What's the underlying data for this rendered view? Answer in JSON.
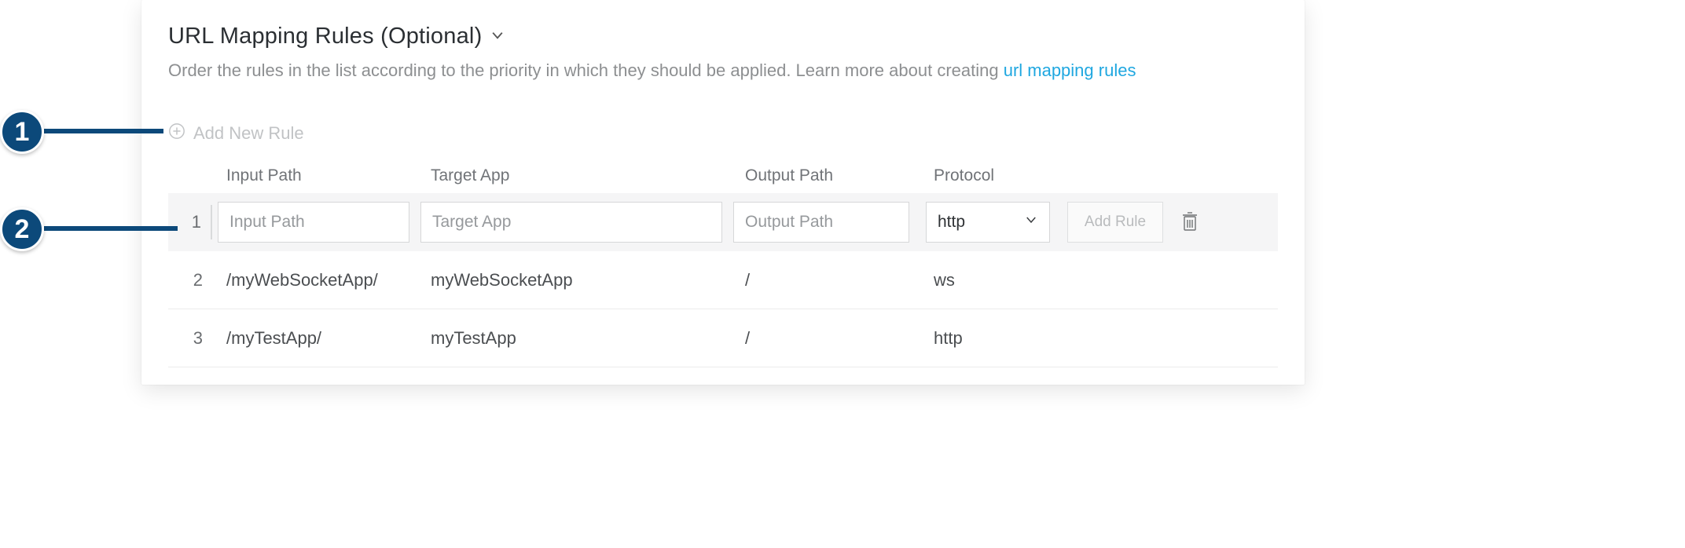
{
  "callouts": {
    "one": "1",
    "two": "2"
  },
  "section": {
    "title": "URL Mapping Rules (Optional)",
    "subtitle_prefix": "Order the rules in the list according to the priority in which they should be applied. Learn more about creating ",
    "subtitle_link": "url mapping rules"
  },
  "add_new": {
    "label": "Add New Rule"
  },
  "table": {
    "headers": {
      "input_path": "Input Path",
      "target_app": "Target App",
      "output_path": "Output Path",
      "protocol": "Protocol"
    },
    "edit_row": {
      "index": "1",
      "input_path_placeholder": "Input Path",
      "target_app_placeholder": "Target App",
      "output_path_placeholder": "Output Path",
      "protocol_value": "http",
      "add_rule_label": "Add Rule"
    },
    "rows": [
      {
        "index": "2",
        "input_path": "/myWebSocketApp/",
        "target_app": "myWebSocketApp",
        "output_path": "/",
        "protocol": "ws"
      },
      {
        "index": "3",
        "input_path": "/myTestApp/",
        "target_app": "myTestApp",
        "output_path": "/",
        "protocol": "http"
      }
    ]
  }
}
